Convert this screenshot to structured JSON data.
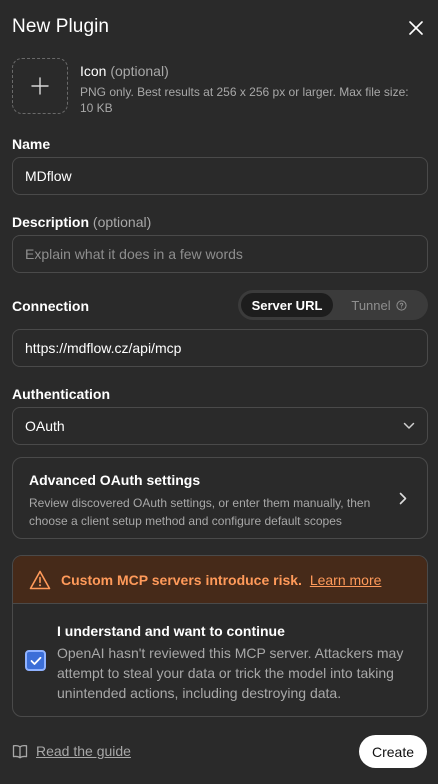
{
  "dialog": {
    "title": "New Plugin"
  },
  "icon": {
    "label": "Icon",
    "optional": "(optional)",
    "help": "PNG only. Best results at 256 x 256 px or larger. Max file size: 10 KB"
  },
  "name": {
    "label": "Name",
    "value": "MDflow"
  },
  "description": {
    "label": "Description",
    "optional": "(optional)",
    "placeholder": "Explain what it does in a few words"
  },
  "connection": {
    "label": "Connection",
    "options": [
      "Server URL",
      "Tunnel"
    ],
    "selected": "Server URL",
    "value": "https://mdflow.cz/api/mcp"
  },
  "authentication": {
    "label": "Authentication",
    "value": "OAuth"
  },
  "advanced": {
    "title": "Advanced OAuth settings",
    "description": "Review discovered OAuth settings, or enter them manually, then choose a client setup method and configure default scopes"
  },
  "risk": {
    "warning": "Custom MCP servers introduce risk.",
    "link": "Learn more",
    "ack_title": "I understand and want to continue",
    "ack_desc": "OpenAI hasn't reviewed this MCP server. Attackers may attempt to steal your data or trick the model into taking unintended actions, including destroying data.",
    "checked": true
  },
  "footer": {
    "guide": "Read the guide",
    "create": "Create"
  },
  "colors": {
    "background": "#2a2a2a",
    "warning": "#ff9a5a",
    "warning_bg": "#462a19",
    "checkbox": "#3c6fd8"
  },
  "icons": [
    "close-icon",
    "plus-icon",
    "help-circle-icon",
    "chevron-down-icon",
    "chevron-right-icon",
    "warning-triangle-icon",
    "checkmark-icon",
    "book-icon"
  ]
}
